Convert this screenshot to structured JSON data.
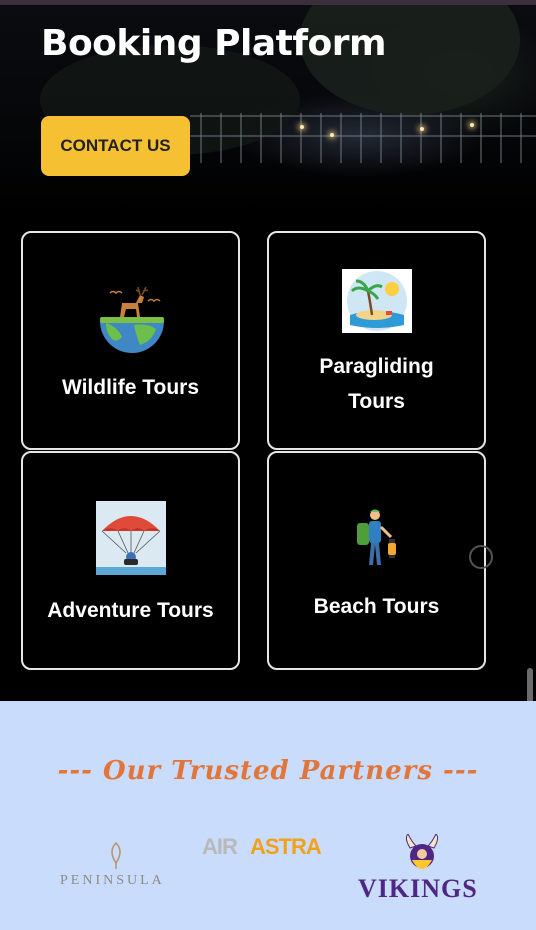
{
  "hero": {
    "title": "Booking Platform",
    "contact_label": "CONTACT US"
  },
  "cards": [
    {
      "label": "Wildlife Tours",
      "icon": "deer-globe-icon"
    },
    {
      "label": "Paragliding Tours",
      "label_line1": "Paragliding",
      "label_line2": "Tours",
      "icon": "palm-island-icon"
    },
    {
      "label": "Adventure Tours",
      "icon": "parachute-icon"
    },
    {
      "label": "Beach Tours",
      "icon": "hiker-icon"
    }
  ],
  "partners": {
    "title": "--- Our Trusted Partners ---",
    "logos": [
      {
        "name": "PENINSULA"
      },
      {
        "name_part1": "AIR",
        "name_part2": "ASTRA"
      },
      {
        "name": "VIKINGS"
      }
    ]
  },
  "colors": {
    "accent": "#f6c033",
    "partners_bg": "#c9dcfb",
    "partners_title": "#e2753a"
  }
}
